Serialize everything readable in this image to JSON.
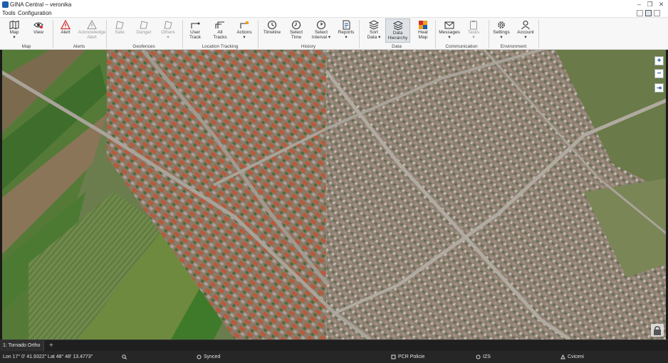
{
  "window": {
    "title": "GINA Central – veronika",
    "controls": {
      "minimize": "–",
      "restore": "❐",
      "close": "✕"
    }
  },
  "menubar": {
    "items": [
      "Tools",
      "Configuration"
    ]
  },
  "ribbon": {
    "groups": [
      {
        "label": "Map"
      },
      {
        "label": "Alerts"
      },
      {
        "label": "Geofences"
      },
      {
        "label": "Location Tracking"
      },
      {
        "label": "History"
      },
      {
        "label": "Data"
      },
      {
        "label": "Communication"
      },
      {
        "label": "Environment"
      }
    ],
    "buttons": [
      {
        "line1": "Map",
        "line2": "▾",
        "icon": "map-icon"
      },
      {
        "line1": "View",
        "line2": "",
        "icon": "eye-icon"
      },
      {
        "line1": "Alert",
        "line2": "",
        "icon": "alert-triangle-icon"
      },
      {
        "line1": "Acknowledge",
        "line2": "Alert",
        "icon": "acknowledge-triangle-icon"
      },
      {
        "line1": "Safe",
        "line2": "",
        "icon": "safe-geofence-icon"
      },
      {
        "line1": "Danger",
        "line2": "",
        "icon": "danger-geofence-icon"
      },
      {
        "line1": "Others",
        "line2": "▾",
        "icon": "others-geofence-icon"
      },
      {
        "line1": "User",
        "line2": "Track",
        "icon": "user-track-icon"
      },
      {
        "line1": "All",
        "line2": "Tracks",
        "icon": "all-tracks-icon"
      },
      {
        "line1": "Actions",
        "line2": "▾",
        "icon": "actions-icon"
      },
      {
        "line1": "Timeline",
        "line2": "",
        "icon": "timeline-clock-icon"
      },
      {
        "line1": "Select",
        "line2": "Time",
        "icon": "select-time-icon"
      },
      {
        "line1": "Select",
        "line2": "Interval ▾",
        "icon": "select-interval-icon"
      },
      {
        "line1": "Reports",
        "line2": "▾",
        "icon": "reports-icon"
      },
      {
        "line1": "Sort",
        "line2": "Data ▾",
        "icon": "sort-data-icon"
      },
      {
        "line1": "Data",
        "line2": "Hierarchy",
        "icon": "data-hierarchy-icon"
      },
      {
        "line1": "Heat",
        "line2": "Map",
        "icon": "heat-map-icon"
      },
      {
        "line1": "Messages",
        "line2": "▾",
        "icon": "messages-envelope-icon"
      },
      {
        "line1": "Tasks",
        "line2": "▾",
        "icon": "tasks-clipboard-icon"
      },
      {
        "line1": "Settings",
        "line2": "▾",
        "icon": "settings-gear-icon"
      },
      {
        "line1": "Account",
        "line2": "▾",
        "icon": "account-user-icon"
      }
    ]
  },
  "map": {
    "layer_tab": "1: Tornado Ortho",
    "add_tab": "+",
    "controls": {
      "zoom_in": "+",
      "zoom_out": "−",
      "fit": "⇥"
    }
  },
  "statusbar": {
    "coordinates": "Lon 17° 0' 41.9322\"  Lat 48° 48' 13.4773\"",
    "sync": "Synced",
    "unit": "PCR Policie",
    "org": "IZS",
    "mode": "Cviceni"
  },
  "colors": {
    "accent": "#1e5fa8",
    "alert_red": "#d32f2f",
    "active_button": "#dfe3e7",
    "status_bg": "#262626"
  }
}
